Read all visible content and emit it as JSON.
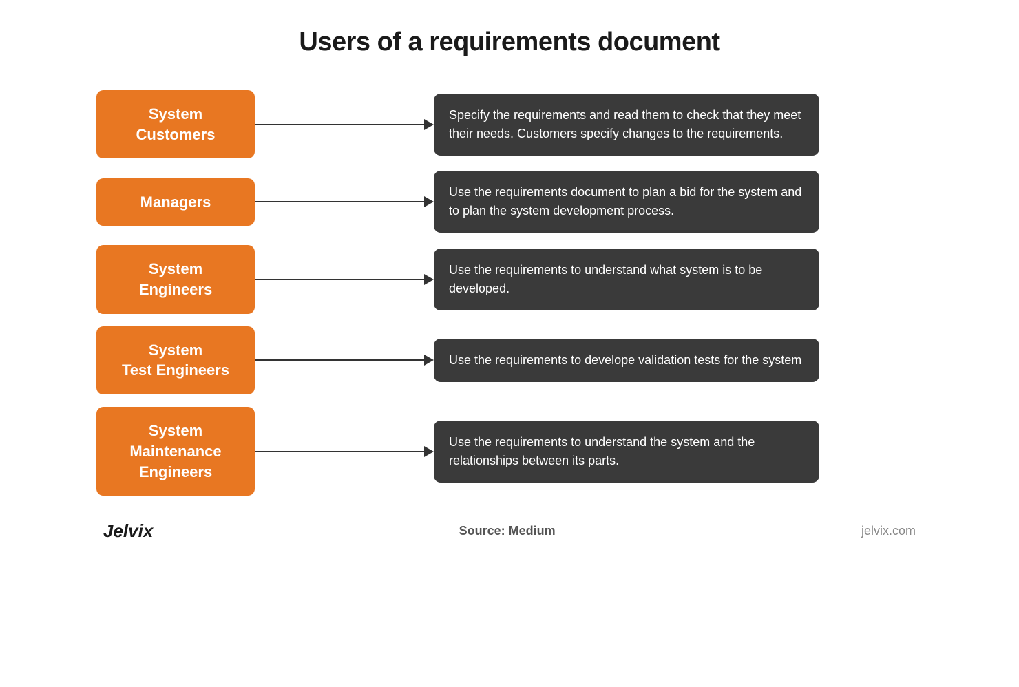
{
  "page": {
    "title": "Users of a requirements document"
  },
  "rows": [
    {
      "id": "system-customers",
      "label": "System\nCustomers",
      "description": "Specify the requirements and read them to check that they meet their needs. Customers specify changes to the requirements."
    },
    {
      "id": "managers",
      "label": "Managers",
      "description": "Use the requirements document to plan a bid for the system and to plan the system development process."
    },
    {
      "id": "system-engineers",
      "label": "System\nEngineers",
      "description": "Use the requirements to understand what system is to be developed."
    },
    {
      "id": "system-test-engineers",
      "label": "System\nTest Engineers",
      "description": "Use the requirements to develope validation tests for the system"
    },
    {
      "id": "system-maintenance-engineers",
      "label": "System\nMaintenance\nEngineers",
      "description": "Use the requirements to understand the system and the relationships between its parts."
    }
  ],
  "footer": {
    "brand": "Jelvix",
    "source_label": "Source:",
    "source_value": "Medium",
    "url": "jelvix.com"
  }
}
